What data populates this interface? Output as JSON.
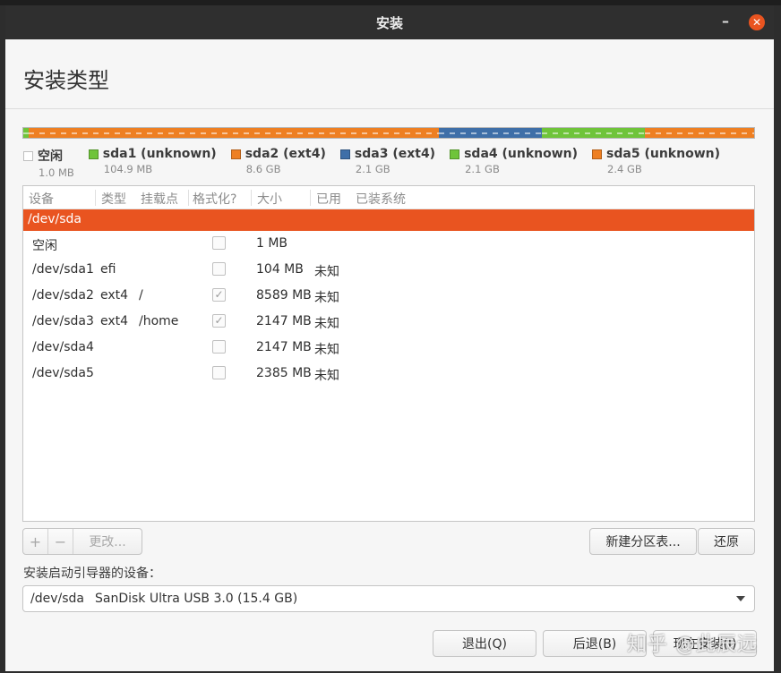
{
  "window": {
    "title": "安装",
    "minimize_glyph": "–",
    "close_glyph": "✕"
  },
  "page": {
    "title": "安装类型"
  },
  "colors": {
    "accent": "#e95420",
    "free": "#ffffff",
    "sda1": "#6fc43a",
    "sda2": "#ee7f22",
    "sda3": "#3f6fa8",
    "sda4": "#6fc43a",
    "sda5": "#ee7f22"
  },
  "partition_bar": [
    {
      "name": "sda-free",
      "fraction": 0.0074
    },
    {
      "name": "sda1",
      "fraction": 0.0
    },
    {
      "name": "sda2",
      "fraction": 0.5618
    },
    {
      "name": "sda3",
      "fraction": 0.1404
    },
    {
      "name": "sda4",
      "fraction": 0.1404
    },
    {
      "name": "sda5",
      "fraction": 0.15
    }
  ],
  "legend": [
    {
      "label": "空闲",
      "size": "1.0 MB",
      "color": "#ffffff"
    },
    {
      "label": "sda1 (unknown)",
      "size": "104.9 MB",
      "color": "#6fc43a"
    },
    {
      "label": "sda2 (ext4)",
      "size": "8.6 GB",
      "color": "#ee7f22"
    },
    {
      "label": "sda3 (ext4)",
      "size": "2.1 GB",
      "color": "#3f6fa8"
    },
    {
      "label": "sda4 (unknown)",
      "size": "2.1 GB",
      "color": "#6fc43a"
    },
    {
      "label": "sda5 (unknown)",
      "size": "2.4 GB",
      "color": "#ee7f22"
    }
  ],
  "table": {
    "headers": {
      "device": "设备",
      "type": "类型",
      "mount": "挂载点",
      "format": "格式化?",
      "size": "大小",
      "used": "已用",
      "system": "已装系统"
    },
    "disk_row": "/dev/sda",
    "rows": [
      {
        "device": "空闲",
        "type": "",
        "mount": "",
        "format": false,
        "size": "1 MB",
        "used": ""
      },
      {
        "device": "/dev/sda1",
        "type": "efi",
        "mount": "",
        "format": false,
        "size": "104 MB",
        "used": "未知"
      },
      {
        "device": "/dev/sda2",
        "type": "ext4",
        "mount": "/",
        "format": true,
        "size": "8589 MB",
        "used": "未知"
      },
      {
        "device": "/dev/sda3",
        "type": "ext4",
        "mount": "/home",
        "format": true,
        "size": "2147 MB",
        "used": "未知"
      },
      {
        "device": "/dev/sda4",
        "type": "",
        "mount": "",
        "format": false,
        "size": "2147 MB",
        "used": "未知"
      },
      {
        "device": "/dev/sda5",
        "type": "",
        "mount": "",
        "format": false,
        "size": "2385 MB",
        "used": "未知"
      }
    ]
  },
  "toolbar": {
    "add": "+",
    "remove": "−",
    "change": "更改..."
  },
  "buttons": {
    "new_table": "新建分区表...",
    "revert": "还原",
    "quit": "退出(Q)",
    "back": "后退(B)",
    "install_now": "现在安装(I)"
  },
  "boot": {
    "label": "安装启动引导器的设备：",
    "device": "/dev/sda",
    "description": "SanDisk Ultra USB 3.0 (15.4 GB)"
  },
  "watermark": "知乎 @此辰远"
}
